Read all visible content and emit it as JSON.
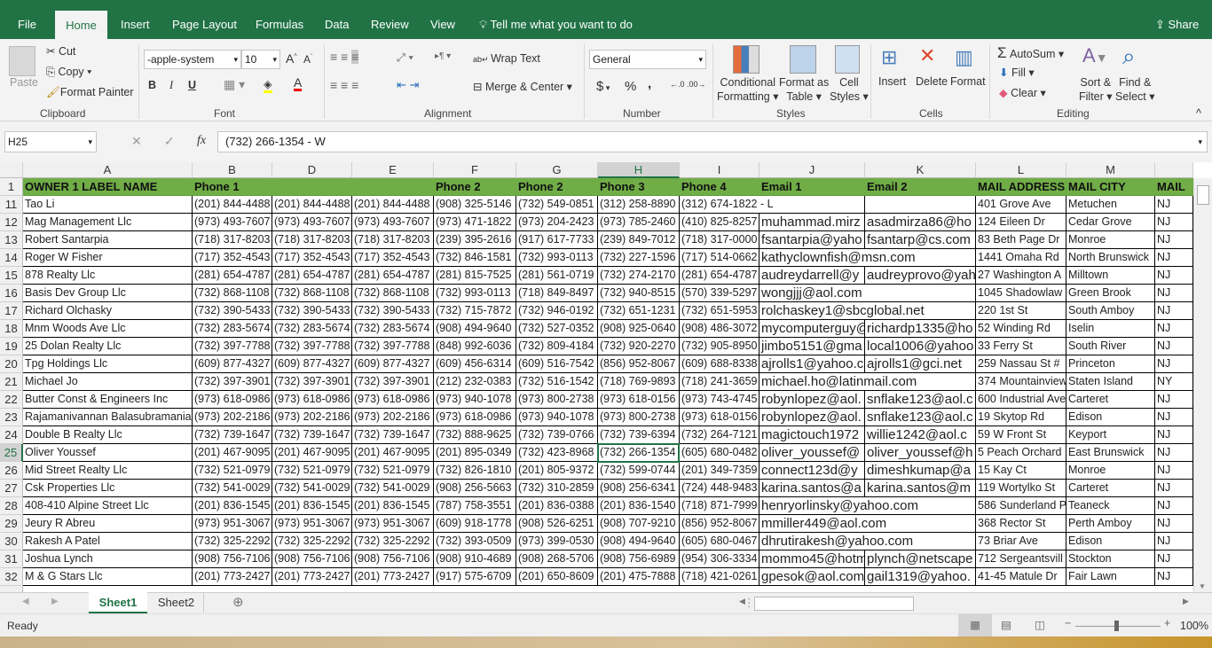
{
  "ribbon_tabs": [
    "File",
    "Home",
    "Insert",
    "Page Layout",
    "Formulas",
    "Data",
    "Review",
    "View"
  ],
  "tell_me": "Tell me what you want to do",
  "share": "Share",
  "clipboard": {
    "paste": "Paste",
    "cut": "Cut",
    "copy": "Copy",
    "format_painter": "Format Painter",
    "label": "Clipboard"
  },
  "font": {
    "name": "-apple-system",
    "size": "10",
    "bold": "B",
    "italic": "I",
    "underline": "U",
    "label": "Font"
  },
  "alignment": {
    "wrap": "Wrap Text",
    "merge": "Merge & Center",
    "label": "Alignment"
  },
  "number": {
    "format": "General",
    "currency": "$",
    "percent": "%",
    "comma": ",",
    "label": "Number"
  },
  "styles": {
    "conditional": "Conditional",
    "conditional2": "Formatting",
    "format_table": "Format as",
    "format_table2": "Table",
    "cell_styles": "Cell",
    "cell_styles2": "Styles",
    "label": "Styles"
  },
  "cells": {
    "insert": "Insert",
    "delete": "Delete",
    "format": "Format",
    "label": "Cells"
  },
  "editing": {
    "autosum": "AutoSum",
    "fill": "Fill",
    "clear": "Clear",
    "sort": "Sort &",
    "sort2": "Filter",
    "find": "Find &",
    "find2": "Select",
    "label": "Editing"
  },
  "formula_bar": {
    "name_box": "H25",
    "formula": "(732) 266-1354 - W"
  },
  "columns": [
    "A",
    "B",
    "D",
    "E",
    "F",
    "G",
    "H",
    "I",
    "J",
    "K",
    "L",
    "M",
    ""
  ],
  "header_row": {
    "num": "1",
    "cells": [
      "OWNER 1 LABEL NAME",
      "Phone 1",
      "",
      "",
      "Phone 2",
      "Phone 2",
      "Phone 3",
      "Phone 4",
      "Email 1",
      "Email 2",
      "MAIL ADDRESS",
      "MAIL CITY",
      "MAIL"
    ]
  },
  "rows": [
    {
      "num": "11",
      "cells": [
        "Tao Li",
        "(201) 844-4488",
        "(201) 844-4488",
        "(201) 844-4488",
        "(908) 325-5146",
        "(732) 549-0851",
        "(312) 258-8890",
        "(312) 674-1822 - L",
        "",
        "",
        "401 Grove Ave",
        "Metuchen",
        "NJ"
      ]
    },
    {
      "num": "12",
      "cells": [
        "Mag Management Llc",
        "(973) 493-7607",
        "(973) 493-7607",
        "(973) 493-7607",
        "(973) 471-1822",
        "(973) 204-2423",
        "(973) 785-2460",
        "(410) 825-8257",
        "muhammad.mirz",
        "asadmirza86@ho",
        "124 Eileen Dr",
        "Cedar Grove",
        "NJ"
      ]
    },
    {
      "num": "13",
      "cells": [
        "Robert Santarpia",
        "(718) 317-8203",
        "(718) 317-8203",
        "(718) 317-8203",
        "(239) 395-2616",
        "(917) 617-7733",
        "(239) 849-7012",
        "(718) 317-0000",
        "fsantarpia@yaho",
        "fsantarp@cs.com",
        "83 Beth Page Dr",
        "Monroe",
        "NJ"
      ]
    },
    {
      "num": "14",
      "cells": [
        "Roger W Fisher",
        "(717) 352-4543",
        "(717) 352-4543",
        "(717) 352-4543",
        "(732) 846-1581",
        "(732) 993-0113",
        "(732) 227-1596",
        "(717) 514-0662",
        "kathyclownfish@msn.com",
        "",
        "1441 Omaha Rd",
        "North Brunswick",
        "NJ"
      ]
    },
    {
      "num": "15",
      "cells": [
        "878 Realty Llc",
        "(281) 654-4787",
        "(281) 654-4787",
        "(281) 654-4787",
        "(281) 815-7525",
        "(281) 561-0719",
        "(732) 274-2170",
        "(281) 654-4787",
        "audreydarrell@y",
        "audreyprovo@yah",
        "27 Washington A",
        "Milltown",
        "NJ"
      ]
    },
    {
      "num": "16",
      "cells": [
        "Basis Dev Group Llc",
        "(732) 868-1108",
        "(732) 868-1108",
        "(732) 868-1108",
        "(732) 993-0113",
        "(718) 849-8497",
        "(732) 940-8515",
        "(570) 339-5297",
        "wongjjj@aol.com",
        "",
        "1045 Shadowlaw",
        "Green Brook",
        "NJ"
      ]
    },
    {
      "num": "17",
      "cells": [
        "Richard Olchasky",
        "(732) 390-5433",
        "(732) 390-5433",
        "(732) 390-5433",
        "(732) 715-7872",
        "(732) 946-0192",
        "(732) 651-1231",
        "(732) 651-5953",
        "rolchaskey1@sbcglobal.net",
        "",
        "220 1st St",
        "South Amboy",
        "NJ"
      ]
    },
    {
      "num": "18",
      "cells": [
        "Mnm Woods Ave Llc",
        "(732) 283-5674",
        "(732) 283-5674",
        "(732) 283-5674",
        "(908) 494-9640",
        "(732) 527-0352",
        "(908) 925-0640",
        "(908) 486-3072",
        "mycomputerguy@",
        "richardp1335@ho",
        "52 Winding Rd",
        "Iselin",
        "NJ"
      ]
    },
    {
      "num": "19",
      "cells": [
        "25 Dolan Realty Llc",
        "(732) 397-7788",
        "(732) 397-7788",
        "(732) 397-7788",
        "(848) 992-6036",
        "(732) 809-4184",
        "(732) 920-2270",
        "(732) 905-8950",
        "jimbo5151@gma",
        "local1006@yahoo",
        "33 Ferry St",
        "South River",
        "NJ"
      ]
    },
    {
      "num": "20",
      "cells": [
        "Tpg Holdings Llc",
        "(609) 877-4327",
        "(609) 877-4327",
        "(609) 877-4327",
        "(609) 456-6314",
        "(609) 516-7542",
        "(856) 952-8067",
        "(609) 688-8338",
        "ajrolls1@yahoo.c",
        "ajrolls1@gci.net",
        "259 Nassau St #",
        "Princeton",
        "NJ"
      ]
    },
    {
      "num": "21",
      "cells": [
        "Michael Jo",
        "(732) 397-3901",
        "(732) 397-3901",
        "(732) 397-3901",
        "(212) 232-0383",
        "(732) 516-1542",
        "(718) 769-9893",
        "(718) 241-3659",
        "michael.ho@latinmail.com",
        "",
        "374 Mountainview",
        "Staten Island",
        "NY"
      ]
    },
    {
      "num": "22",
      "cells": [
        "Butter Const & Engineers Inc",
        "(973) 618-0986",
        "(973) 618-0986",
        "(973) 618-0986",
        "(973) 940-1078",
        "(973) 800-2738",
        "(973) 618-0156",
        "(973) 743-4745",
        "robynlopez@aol.",
        "snflake123@aol.c",
        "600 Industrial Ave",
        "Carteret",
        "NJ"
      ]
    },
    {
      "num": "23",
      "cells": [
        "Rajamanivannan Balasubramaniam",
        "(973) 202-2186",
        "(973) 202-2186",
        "(973) 202-2186",
        "(973) 618-0986",
        "(973) 940-1078",
        "(973) 800-2738",
        "(973) 618-0156",
        "robynlopez@aol.",
        "snflake123@aol.c",
        "19 Skytop Rd",
        "Edison",
        "NJ"
      ]
    },
    {
      "num": "24",
      "cells": [
        "Double B Realty Llc",
        "(732) 739-1647",
        "(732) 739-1647",
        "(732) 739-1647",
        "(732) 888-9625",
        "(732) 739-0766",
        "(732) 739-6394",
        "(732) 264-7121",
        "magictouch1972",
        "willie1242@aol.c",
        "59 W Front St",
        "Keyport",
        "NJ"
      ]
    },
    {
      "num": "25",
      "cells": [
        "Oliver Youssef",
        "(201) 467-9095",
        "(201) 467-9095",
        "(201) 467-9095",
        "(201) 895-0349",
        "(732) 423-8968",
        "(732) 266-1354",
        "(605) 680-0482",
        "oliver_youssef@",
        "oliver_youssef@h",
        "5 Peach Orchard",
        "East Brunswick",
        "NJ"
      ]
    },
    {
      "num": "26",
      "cells": [
        "Mid Street Realty Llc",
        "(732) 521-0979",
        "(732) 521-0979",
        "(732) 521-0979",
        "(732) 826-1810",
        "(201) 805-9372",
        "(732) 599-0744",
        "(201) 349-7359",
        "connect123d@y",
        "dimeshkumap@a",
        "15 Kay Ct",
        "Monroe",
        "NJ"
      ]
    },
    {
      "num": "27",
      "cells": [
        "Csk Properties Llc",
        "(732) 541-0029",
        "(732) 541-0029",
        "(732) 541-0029",
        "(908) 256-5663",
        "(732) 310-2859",
        "(908) 256-6341",
        "(724) 448-9483",
        "karina.santos@a",
        "karina.santos@m",
        "119 Wortylko St",
        "Carteret",
        "NJ"
      ]
    },
    {
      "num": "28",
      "cells": [
        "408-410 Alpine Street Llc",
        "(201) 836-1545",
        "(201) 836-1545",
        "(201) 836-1545",
        "(787) 758-3551",
        "(201) 836-0388",
        "(201) 836-1540",
        "(718) 871-7999",
        "henryorlinsky@yahoo.com",
        "",
        "586 Sunderland P",
        "Teaneck",
        "NJ"
      ]
    },
    {
      "num": "29",
      "cells": [
        "Jeury R Abreu",
        "(973) 951-3067",
        "(973) 951-3067",
        "(973) 951-3067",
        "(609) 918-1778",
        "(908) 526-6251",
        "(908) 707-9210",
        "(856) 952-8067",
        "mmiller449@aol.com",
        "",
        "368 Rector St",
        "Perth Amboy",
        "NJ"
      ]
    },
    {
      "num": "30",
      "cells": [
        "Rakesh A Patel",
        "(732) 325-2292",
        "(732) 325-2292",
        "(732) 325-2292",
        "(732) 393-0509",
        "(973) 399-0530",
        "(908) 494-9640",
        "(605) 680-0467",
        "dhrutirakesh@yahoo.com",
        "",
        "73 Briar Ave",
        "Edison",
        "NJ"
      ]
    },
    {
      "num": "31",
      "cells": [
        "Joshua Lynch",
        "(908) 756-7106",
        "(908) 756-7106",
        "(908) 756-7106",
        "(908) 910-4689",
        "(908) 268-5706",
        "(908) 756-6989",
        "(954) 306-3334",
        "mommo45@hotm",
        "plynch@netscape",
        "712 Sergeantsvill",
        "Stockton",
        "NJ"
      ]
    },
    {
      "num": "32",
      "cells": [
        "M & G Stars Llc",
        "(201) 773-2427",
        "(201) 773-2427",
        "(201) 773-2427",
        "(917) 575-6709",
        "(201) 650-8609",
        "(201) 475-7888",
        "(718) 421-0261",
        "gpesok@aol.com",
        "gail1319@yahoo.",
        "41-45 Matule Dr",
        "Fair Lawn",
        "NJ"
      ]
    }
  ],
  "sheets": [
    "Sheet1",
    "Sheet2"
  ],
  "status": {
    "ready": "Ready",
    "zoom": "100%"
  },
  "colors": {
    "excel_green": "#217346",
    "header_fill": "#70ad47"
  }
}
